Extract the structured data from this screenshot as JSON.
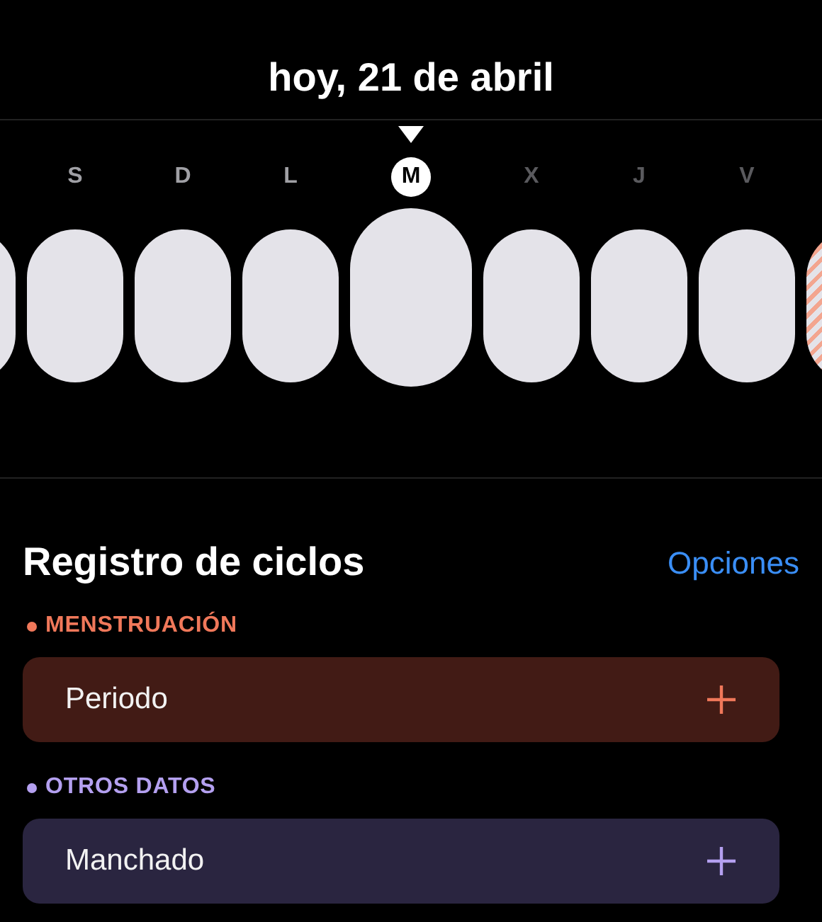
{
  "header": {
    "title": "hoy, 21 de abril"
  },
  "days": [
    {
      "kind": "partial",
      "selected": false
    },
    {
      "kind": "past",
      "label": "S",
      "selected": false
    },
    {
      "kind": "past",
      "label": "D",
      "selected": false
    },
    {
      "kind": "past",
      "label": "L",
      "selected": false
    },
    {
      "kind": "past",
      "label": "M",
      "selected": true
    },
    {
      "kind": "future",
      "label": "X",
      "selected": false
    },
    {
      "kind": "future",
      "label": "J",
      "selected": false
    },
    {
      "kind": "future",
      "label": "V",
      "selected": false
    },
    {
      "kind": "predicted",
      "selected": false
    }
  ],
  "log": {
    "title": "Registro de ciclos",
    "options": "Opciones",
    "sections": [
      {
        "label": "MENSTRUACIÓN",
        "color": "#f0785a",
        "items": [
          {
            "label": "Periodo"
          }
        ]
      },
      {
        "label": "OTROS DATOS",
        "color": "#b4a0f0",
        "items": [
          {
            "label": "Manchado"
          }
        ]
      }
    ]
  }
}
